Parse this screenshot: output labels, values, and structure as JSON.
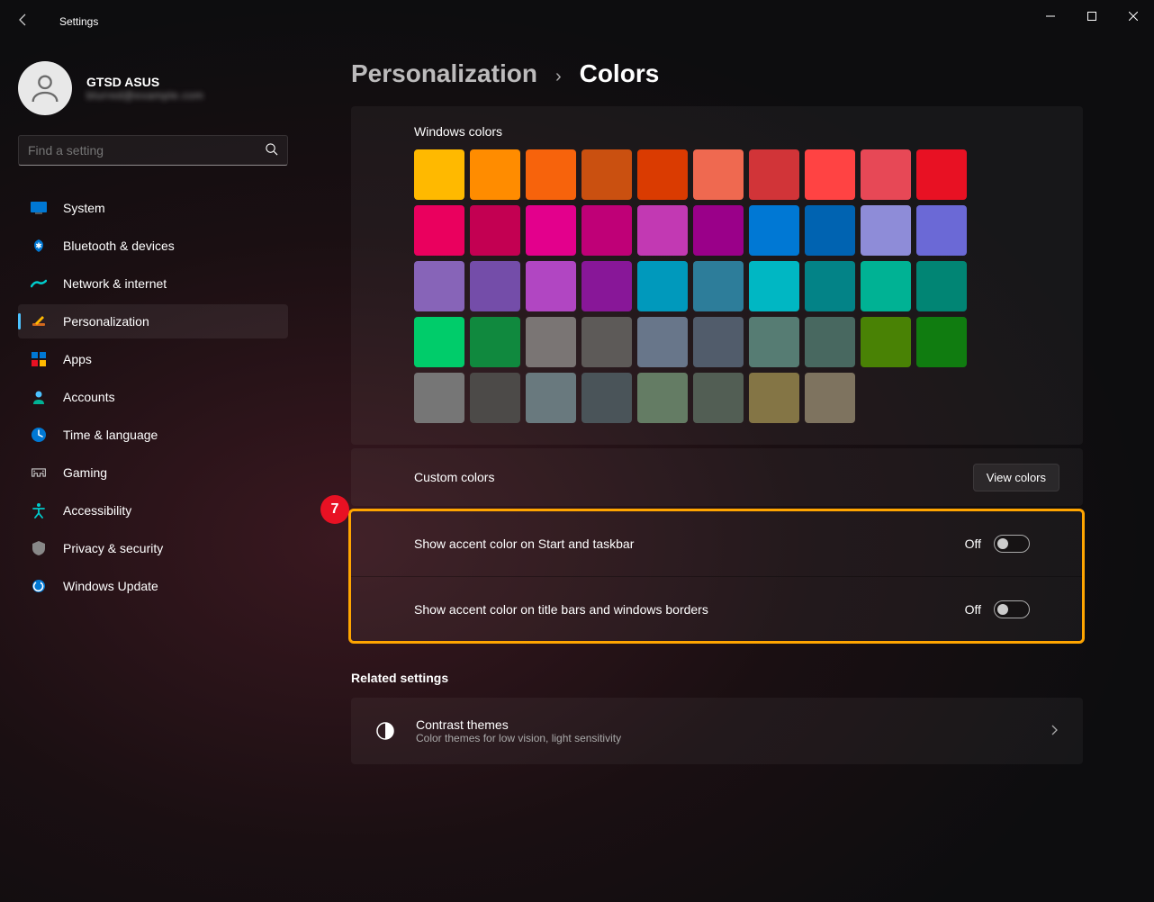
{
  "app_title": "Settings",
  "profile": {
    "name": "GTSD ASUS",
    "email": "blurred@example.com"
  },
  "search_placeholder": "Find a setting",
  "nav_items": [
    {
      "label": "System"
    },
    {
      "label": "Bluetooth & devices"
    },
    {
      "label": "Network & internet"
    },
    {
      "label": "Personalization",
      "active": true
    },
    {
      "label": "Apps"
    },
    {
      "label": "Accounts"
    },
    {
      "label": "Time & language"
    },
    {
      "label": "Gaming"
    },
    {
      "label": "Accessibility"
    },
    {
      "label": "Privacy & security"
    },
    {
      "label": "Windows Update"
    }
  ],
  "breadcrumb": {
    "parent": "Personalization",
    "sep": "›",
    "current": "Colors"
  },
  "colors_panel_title": "Windows colors",
  "windows_colors": [
    "#ffb900",
    "#ff8c00",
    "#f7630c",
    "#ca5010",
    "#da3b01",
    "#ef6950",
    "#d13438",
    "#ff4343",
    "#e74856",
    "#e81123",
    "#ea005e",
    "#c30052",
    "#e3008c",
    "#bf0077",
    "#c239b3",
    "#9a0089",
    "#0078d4",
    "#0063b1",
    "#8e8cd8",
    "#6b69d6",
    "#8764b8",
    "#744da9",
    "#b146c2",
    "#881798",
    "#0099bc",
    "#2d7d9a",
    "#00b7c3",
    "#038387",
    "#00b294",
    "#018574",
    "#00cc6a",
    "#10893e",
    "#7a7574",
    "#5d5a58",
    "#68768a",
    "#515c6b",
    "#567c73",
    "#486860",
    "#498205",
    "#107c10",
    "#767676",
    "#4c4a48",
    "#69797e",
    "#4a5459",
    "#647c64",
    "#525e54",
    "#847545",
    "#7e735f"
  ],
  "custom_colors_label": "Custom colors",
  "view_colors_btn": "View colors",
  "accent_rows": [
    {
      "label": "Show accent color on Start and taskbar",
      "state": "Off"
    },
    {
      "label": "Show accent color on title bars and windows borders",
      "state": "Off"
    }
  ],
  "step_number": "7",
  "related_title": "Related settings",
  "contrast": {
    "title": "Contrast themes",
    "sub": "Color themes for low vision, light sensitivity"
  }
}
